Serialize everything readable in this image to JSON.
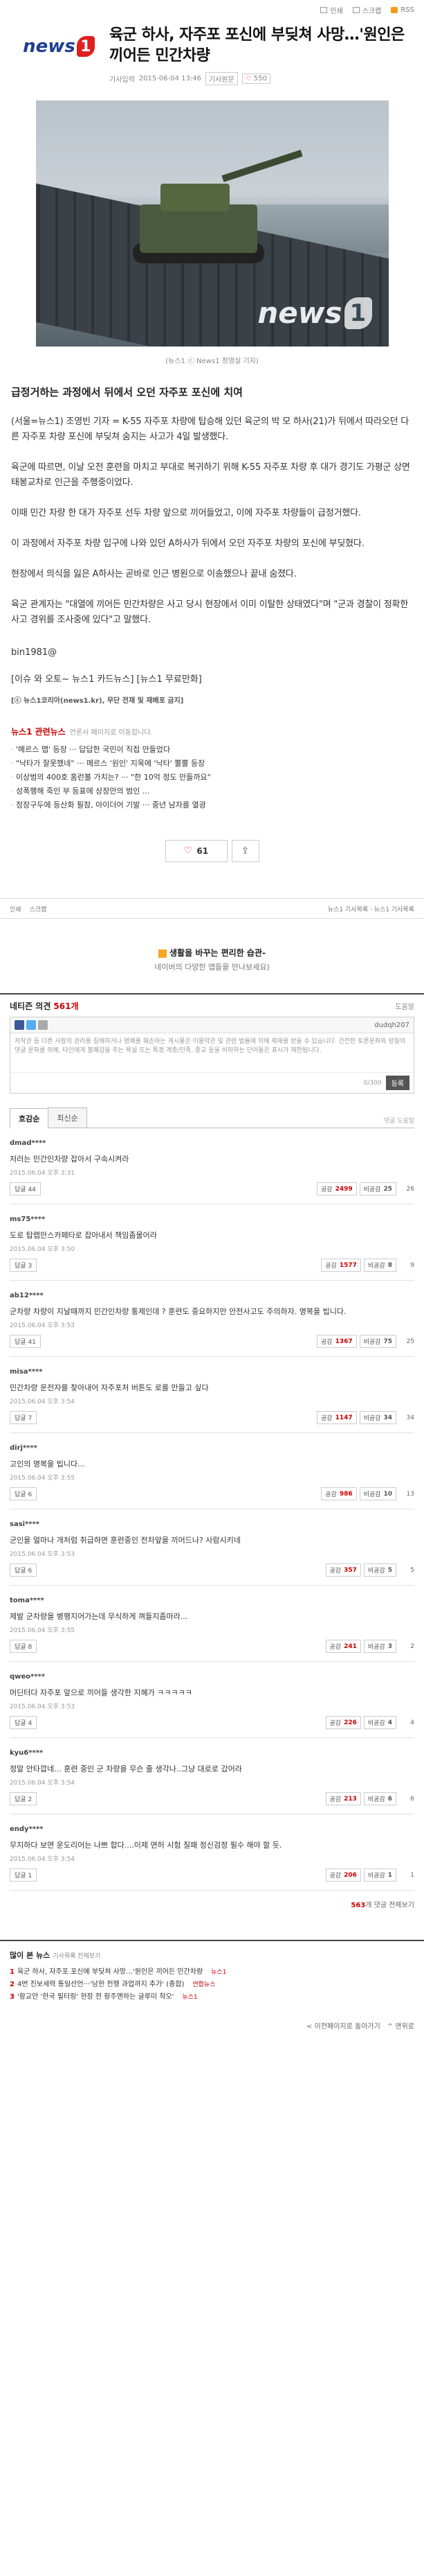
{
  "toolbar": {
    "print_label": "인쇄",
    "scrap_label": "스크랩",
    "rss_label": "RSS"
  },
  "header": {
    "logo_text": "news",
    "logo_digit": "1",
    "headline": "육군 하사, 자주포 포신에 부딪쳐 사망…'원인은 끼어든 민간차량",
    "reporter": "기사입력",
    "datetime": "2015-06-04 13:46",
    "edit_label": "기사원문",
    "like_count": "550"
  },
  "photo": {
    "watermark": "news",
    "watermark_digit": "1",
    "caption": "(뉴스1 ⓒ News1 정영실 기자)"
  },
  "article": {
    "subhead": "급정거하는 과정에서 뒤에서 오던 자주포 포신에 치여",
    "paragraphs": [
      "(서울=뉴스1) 조영빈 기자 = K-55 자주포 차량에 탑승해 있던 육군의 박 모 하사(21)가 뒤에서 따라오던 다른 자주포 차량 포신에 부딪쳐 숨지는 사고가 4일 발생했다.",
      "육군에 따르면, 이날 오전 훈련을 마치고 부대로 복귀하기 위해 K-55 자주포 차량 후 대가 경기도 가평군 상면 태봉교차로 인근을 주행중이었다.",
      "이때 민간 차량 한 대가 자주포 선두 차량 앞으로 끼어들었고, 이에 자주포 차량들이 급정거했다.",
      "이 과정에서 자주포 차량 입구에 나와 있던 A하사가 뒤에서 오던 자주포 차량의 포신에 부딪혔다.",
      "현장에서 의식을 잃은 A하사는 곧바로 인근 병원으로 이송했으나 끝내 숨졌다.",
      "육군 관계자는 \"대열에 끼어든 민간차량은 사고 당시 현장에서 이미 이탈한 상태였다\"며 \"군과 경찰이 정확한 사고 경위를 조사중에 있다\"고 말했다."
    ],
    "byline": "bin1981@",
    "promo": "[이슈 와 오토~ 뉴스1 카드뉴스] [뉴스1 무료만화]",
    "copyright": "[ⓒ 뉴스1코리아(news1.kr), 무단 전재 및 재배포 금지]"
  },
  "related": {
    "title": "뉴스1 관련뉴스",
    "subtitle": "언론사 페이지로 이동합니다.",
    "items": [
      "'메르스 맵' 등장 ··· 답답한 국민이 직접 만들었다",
      "\"낙타가 잘못했네\" ··· 메르스 '원인' 지목에 '낙타' 뿔뿔 등장",
      "이상범의 400호 홈런볼 가치는? ··· \"한 10억 정도 만들까요\"",
      "성폭행해 죽인 부 등표에 상장만의 범인 ...",
      "정장구두에 등산화 필참, 아이더어 기발 ··· 중년 남자를 열광"
    ]
  },
  "actions": {
    "like_count": "61",
    "share_label": "공유"
  },
  "footer_tools": {
    "print": "인쇄",
    "scrap": "스크랩",
    "right": "뉴스1 기사목록 · 뉴스1 기사목록"
  },
  "ad": {
    "title": "생활을 바꾸는 편리한 습관-",
    "subtitle": "네이버의 다양한 앱들을 만나보세요)"
  },
  "comments": {
    "title": "네티즌 의견",
    "count": "561개",
    "help": "도움말",
    "user": "dudqh207",
    "placeholder": "저작권 등 다른 사람의 권리를 침해하거나 명예를 훼손하는 게시물은 이용약관 및 관련 법률에 의해 제재를 받을 수 있습니다. 건전한 토론문화와 양질의 댓글 문화를 위해, 타인에게 불쾌감을 주는 욕설 또는 특정 계층/민족, 종교 등을 비하하는 단어들은 표시가 제한됩니다.",
    "counter": "0/300",
    "submit": "등록",
    "tab_best": "호감순",
    "tab_latest": "최신순",
    "tab_right": "댓글 도움말",
    "reply_label": "답글",
    "like_label": "공감",
    "dislike_label": "비공감",
    "items": [
      {
        "user": "dmad****",
        "text": "저러는 민간인차량 잡아서 구속시켜라",
        "date": "2015.06.04 오후 3:31",
        "replies": "44",
        "likes": "2499",
        "dislikes": "25",
        "sum": "26"
      },
      {
        "user": "ms75****",
        "text": "도로 탑랩만스카페타로 잡아내서 책임좀물어라",
        "date": "2015.06.04 오후 3:50",
        "replies": "3",
        "likes": "1577",
        "dislikes": "8",
        "sum": "9"
      },
      {
        "user": "ab12****",
        "text": "군차량 차량이 지날때까지 민간인차량 통제인데 ? 훈련도 중요하지만 안전사고도 주의하자. 명복을 빕니다.",
        "date": "2015.06.04 오후 3:53",
        "replies": "41",
        "likes": "1367",
        "dislikes": "75",
        "sum": "25"
      },
      {
        "user": "misa****",
        "text": "민간차량 운전자를 찾아내어 자주포처 버튼도 로를 만들고 싶다",
        "date": "2015.06.04 오후 3:54",
        "replies": "7",
        "likes": "1147",
        "dislikes": "34",
        "sum": "34"
      },
      {
        "user": "dirj****",
        "text": "고인의 명복을 빕니다...",
        "date": "2015.06.04 오후 3:55",
        "replies": "6",
        "likes": "986",
        "dislikes": "10",
        "sum": "13"
      },
      {
        "user": "sasi****",
        "text": "군인을 얼마나 개처럼 취급하면 훈련중인 전차앞을 끼어드나? 사람시키네",
        "date": "2015.06.04 오후 3:53",
        "replies": "6",
        "likes": "357",
        "dislikes": "5",
        "sum": "5"
      },
      {
        "user": "toma****",
        "text": "제발 군차량을 병행지어가는데 무식하게 껴들지좀마라...",
        "date": "2015.06.04 오후 3:55",
        "replies": "8",
        "likes": "241",
        "dislikes": "3",
        "sum": "2"
      },
      {
        "user": "qweo****",
        "text": "머딘터다 자주포 앞으로 끼어들 생각한 지혜가 ㅋㅋㅋㅋㅋ",
        "date": "2015.06.04 오후 3:53",
        "replies": "4",
        "likes": "226",
        "dislikes": "4",
        "sum": "4"
      },
      {
        "user": "kyu6****",
        "text": "정말 안타깝네... 훈련 중인 군 차량을 무슨 줄 생각나..그냥 대로로 갔어라",
        "date": "2015.06.04 오후 3:54",
        "replies": "2",
        "likes": "213",
        "dislikes": "6",
        "sum": "6"
      },
      {
        "user": "endy****",
        "text": "무지하다 보면 운도리어는 나쁘 합다....이제 면허 시험 질패 정신검정 필수 해야 할 듯.",
        "date": "2015.06.04 오후 3:54",
        "replies": "1",
        "likes": "206",
        "dislikes": "1",
        "sum": "1"
      }
    ],
    "more_count": "563",
    "more_label": "개 댓글 전체보기"
  },
  "popular": {
    "title": "많이 본 뉴스",
    "subtitle": "기사목록 전체보기",
    "items": [
      {
        "rank": "1",
        "text": "육군 하사, 자주포 포신에 부딪쳐 사망…'원인은 끼어든 민간차량",
        "src": "뉴스1"
      },
      {
        "rank": "2",
        "text": "4번 진보세력 통일선언···'남한 전쟁 과업까지 추가' (종합)",
        "src": "연합뉴스"
      },
      {
        "rank": "3",
        "text": "'황교안 '한국 필터링' 현장 전 황주엔하는 글루미 착오'",
        "src": "뉴스1"
      }
    ]
  },
  "bottom_nav": {
    "prev": "< 이전페이지로 돌아가기",
    "top": "^ 맨위로"
  }
}
